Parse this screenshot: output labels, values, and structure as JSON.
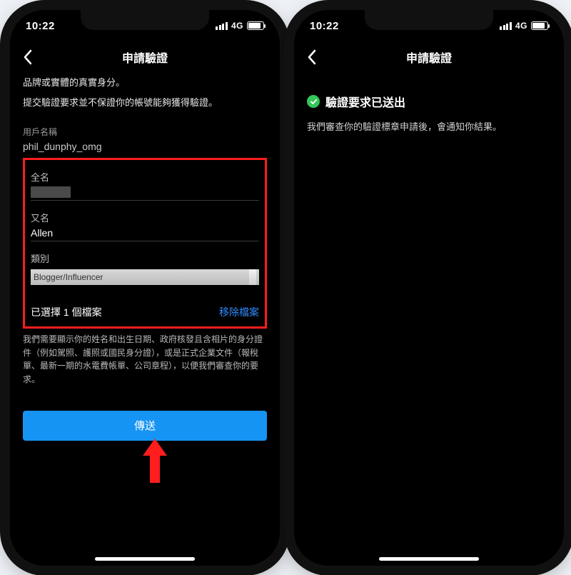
{
  "status": {
    "time": "10:22",
    "network": "4G"
  },
  "left": {
    "title": "申請驗證",
    "body_a": "品牌或實體的真實身分。",
    "body_b": "提交驗證要求並不保證你的帳號能夠獲得驗證。",
    "username_label": "用戶名稱",
    "username_value": "phil_dunphy_omg",
    "fullname_label": "全名",
    "fullname_value": "",
    "aka_label": "又名",
    "aka_value": "Allen",
    "category_label": "類別",
    "category_value": "Blogger/Influencer",
    "file_selected": "已選擇 1 個檔案",
    "file_remove": "移除檔案",
    "desc": "我們需要顯示你的姓名和出生日期、政府核發且含相片的身分證件（例如駕照、護照或國民身分證），或是正式企業文件（報稅單、最新一期的水電費帳單、公司章程），以便我們審查你的要求。",
    "submit": "傳送"
  },
  "right": {
    "title": "申請驗證",
    "suc_title": "驗證要求已送出",
    "suc_body": "我們審查你的驗證標章申請後，會通知你結果。"
  }
}
